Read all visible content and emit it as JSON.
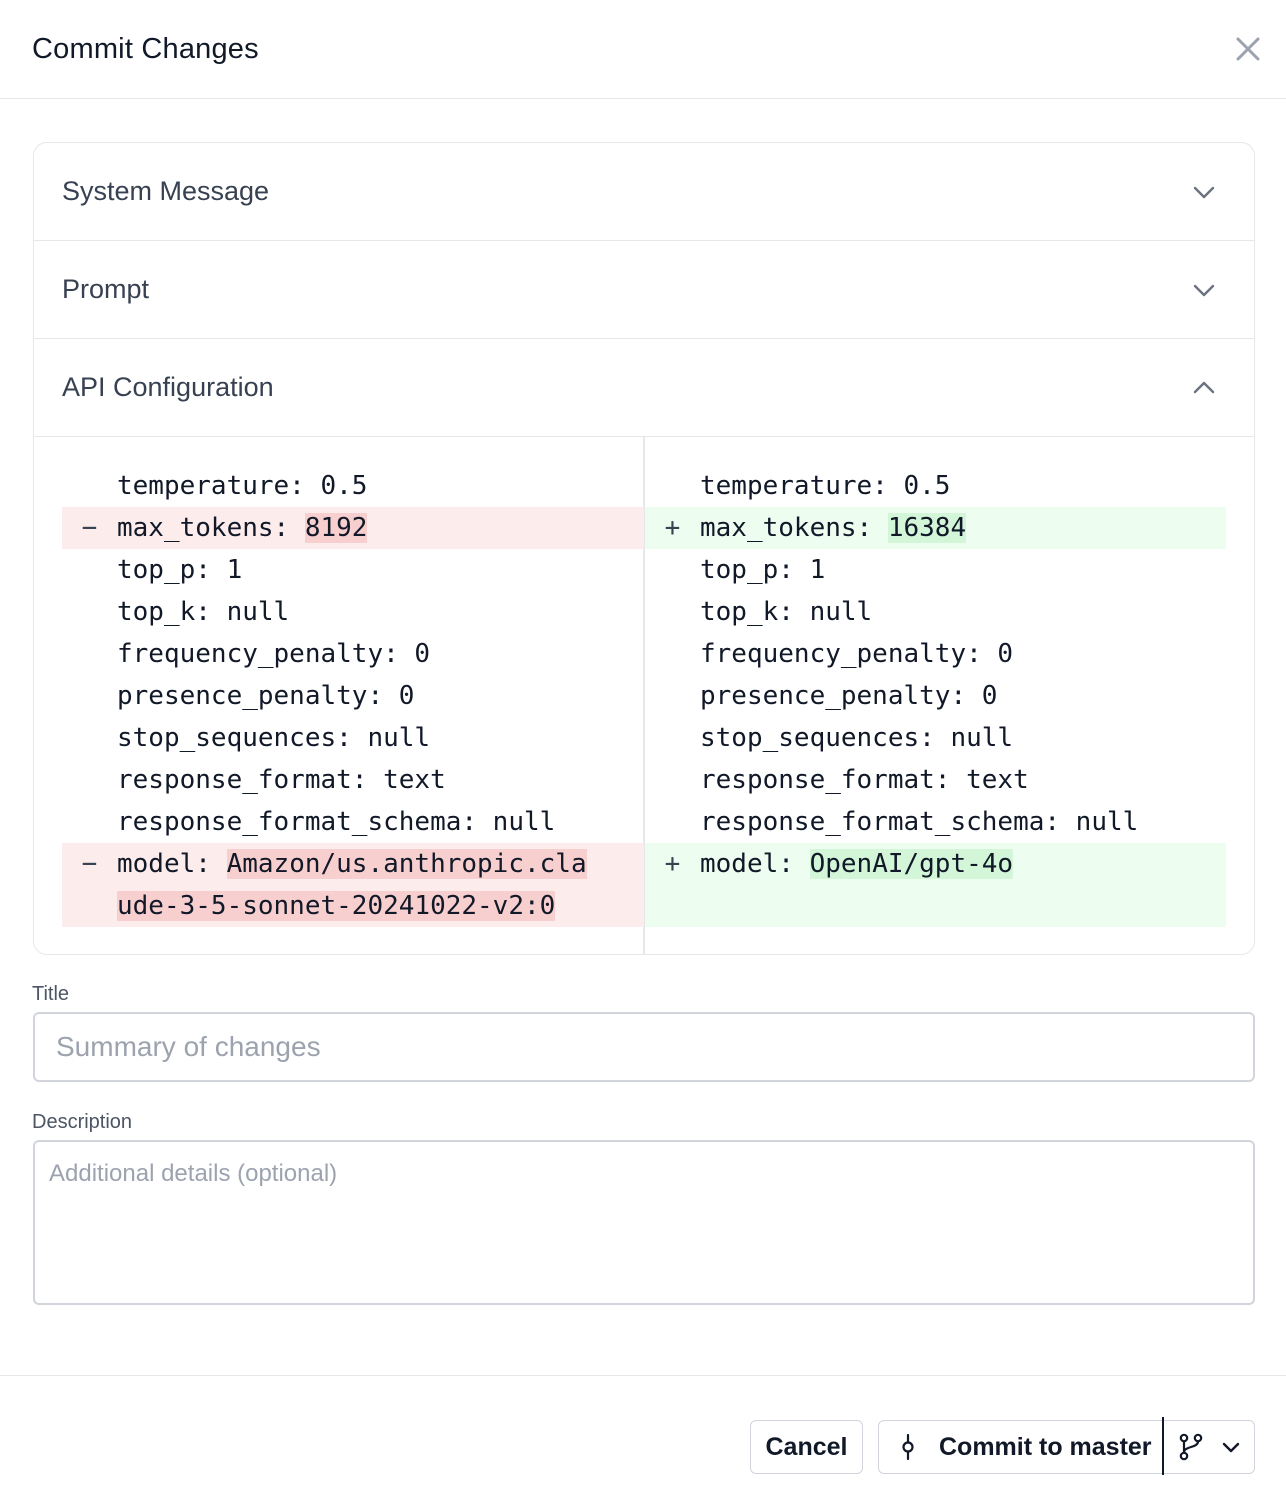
{
  "modal": {
    "title": "Commit Changes"
  },
  "sections": [
    {
      "label": "System Message",
      "expanded": false
    },
    {
      "label": "Prompt",
      "expanded": false
    },
    {
      "label": "API Configuration",
      "expanded": true
    }
  ],
  "diff": {
    "left": [
      {
        "type": "same",
        "marker": "",
        "text": "temperature: 0.5"
      },
      {
        "type": "del",
        "marker": "−",
        "prefix": "max_tokens: ",
        "value": "8192"
      },
      {
        "type": "same",
        "marker": "",
        "text": "top_p: 1"
      },
      {
        "type": "same",
        "marker": "",
        "text": "top_k: null"
      },
      {
        "type": "same",
        "marker": "",
        "text": "frequency_penalty: 0"
      },
      {
        "type": "same",
        "marker": "",
        "text": "presence_penalty: 0"
      },
      {
        "type": "same",
        "marker": "",
        "text": "stop_sequences: null"
      },
      {
        "type": "same",
        "marker": "",
        "text": "response_format: text"
      },
      {
        "type": "same",
        "marker": "",
        "text": "response_format_schema: null"
      },
      {
        "type": "del",
        "marker": "−",
        "prefix": "model: ",
        "value": "Amazon/us.anthropic.cla",
        "continuation": "ude-3-5-sonnet-20241022-v2:0"
      }
    ],
    "right": [
      {
        "type": "same",
        "marker": "",
        "text": "temperature: 0.5"
      },
      {
        "type": "add",
        "marker": "+",
        "prefix": "max_tokens: ",
        "value": "16384"
      },
      {
        "type": "same",
        "marker": "",
        "text": "top_p: 1"
      },
      {
        "type": "same",
        "marker": "",
        "text": "top_k: null"
      },
      {
        "type": "same",
        "marker": "",
        "text": "frequency_penalty: 0"
      },
      {
        "type": "same",
        "marker": "",
        "text": "presence_penalty: 0"
      },
      {
        "type": "same",
        "marker": "",
        "text": "stop_sequences: null"
      },
      {
        "type": "same",
        "marker": "",
        "text": "response_format: text"
      },
      {
        "type": "same",
        "marker": "",
        "text": "response_format_schema: null"
      },
      {
        "type": "add",
        "marker": "+",
        "prefix": "model: ",
        "value": "OpenAI/gpt-4o",
        "continuation": ""
      }
    ]
  },
  "form": {
    "title_label": "Title",
    "title_placeholder": "Summary of changes",
    "description_label": "Description",
    "description_placeholder": "Additional details (optional)"
  },
  "footer": {
    "cancel_label": "Cancel",
    "commit_label": "Commit to master"
  },
  "icons": {
    "close": "close-icon",
    "chevron_down": "chevron-down-icon",
    "chevron_up": "chevron-up-icon",
    "commit": "git-commit-icon",
    "branch": "git-branch-icon"
  },
  "colors": {
    "deleted_line": "#fdecec",
    "deleted_highlight": "#f8cfcf",
    "added_line": "#edfdf0",
    "added_highlight": "#d3f6d9",
    "border": "#e5e7eb"
  }
}
